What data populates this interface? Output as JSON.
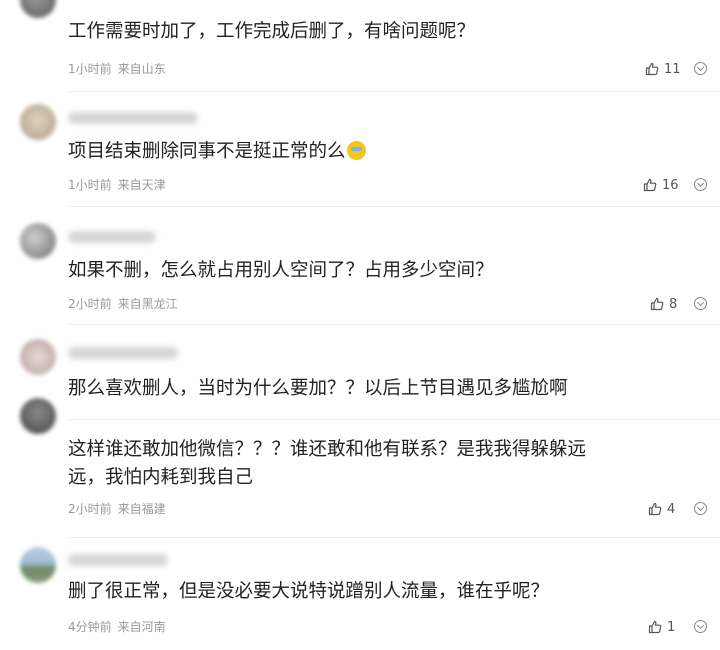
{
  "comments": [
    {
      "text": "工作需要时加了，工作完成后删了，有啥问题呢？",
      "time": "1小时前",
      "location": "来自山东",
      "likes": "11"
    },
    {
      "text": "项目结束删除同事不是挺正常的么",
      "time": "1小时前",
      "location": "来自天津",
      "likes": "16"
    },
    {
      "text": "如果不删，怎么就占用别人空间了？占用多少空间？",
      "time": "2小时前",
      "location": "来自黑龙江",
      "likes": "8"
    },
    {
      "text": "那么喜欢删人，当时为什么要加？？以后上节目遇见多尴尬啊"
    },
    {
      "text": "这样谁还敢加他微信？？？谁还敢和他有联系？是我我得躲躲远远，我怕内耗到我自己",
      "time": "2小时前",
      "location": "来自福建",
      "likes": "4"
    },
    {
      "text": "删了很正常，但是没必要大说特说蹭别人流量，谁在乎呢？",
      "time": "4分钟前",
      "location": "来自河南",
      "likes": "1"
    }
  ],
  "colors": {
    "text": "#222222",
    "meta": "#999999",
    "icon": "#555555"
  },
  "icons": {
    "like": "thumbs-up-icon",
    "more": "chevron-circle-icon",
    "emoji": "crying-laughing-emoji-icon"
  }
}
